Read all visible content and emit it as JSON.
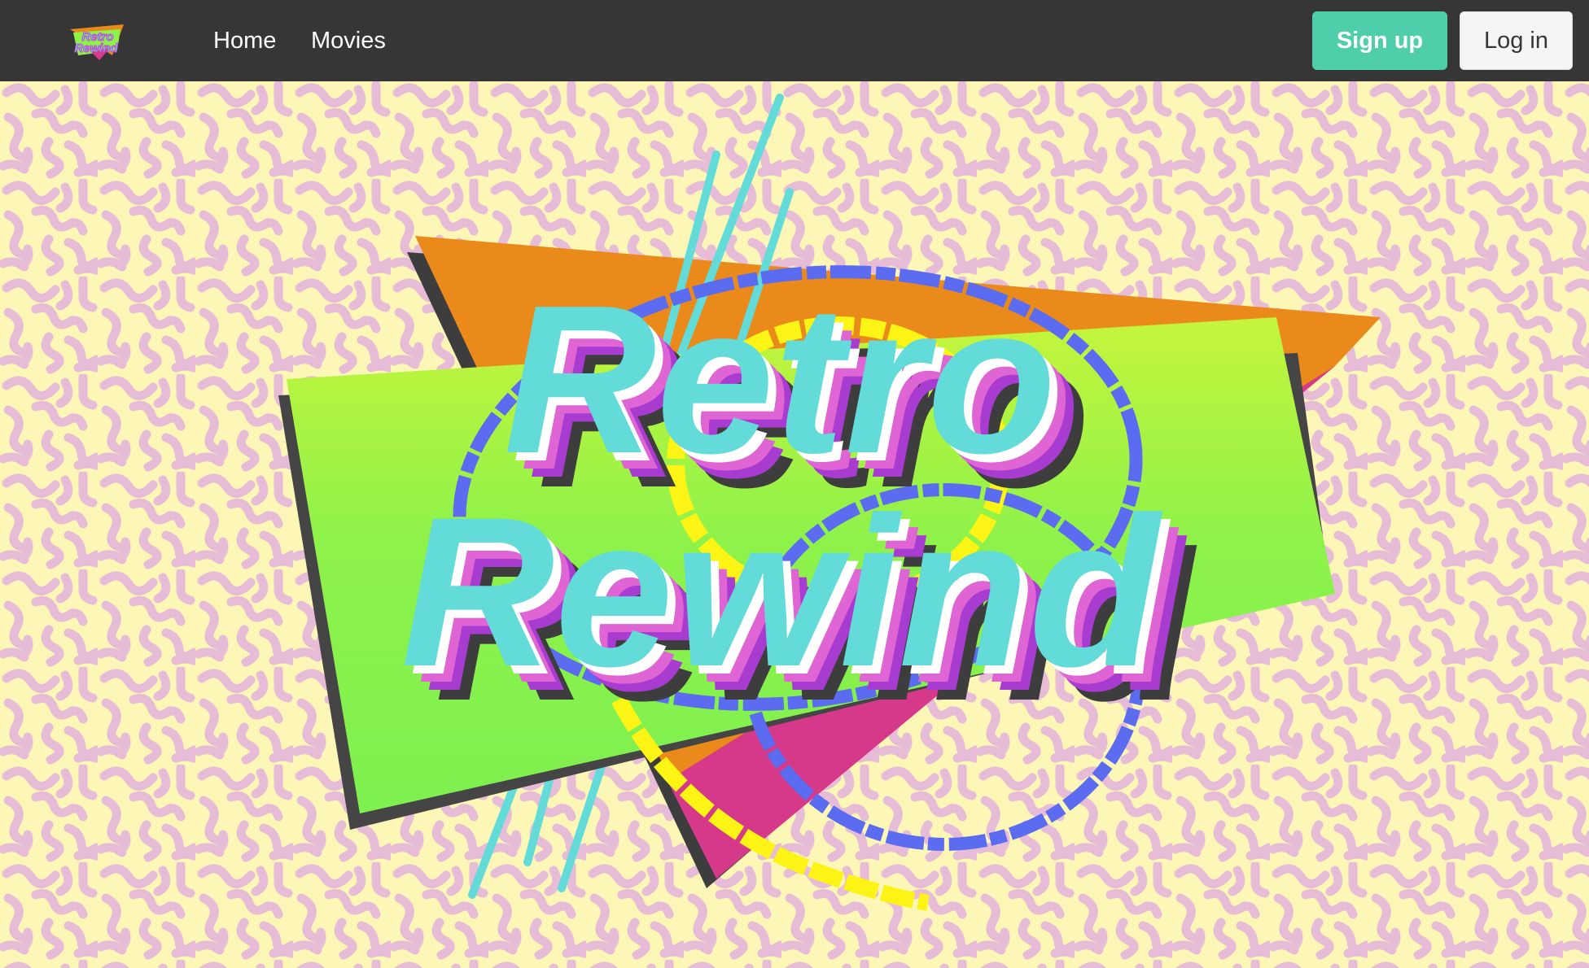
{
  "nav": {
    "logo_alt": "Retro Rewind",
    "links": [
      {
        "label": "Home"
      },
      {
        "label": "Movies"
      }
    ],
    "signup_label": "Sign up",
    "login_label": "Log in"
  },
  "hero": {
    "logo_line1": "Retro",
    "logo_line2": "Rewind"
  },
  "colors": {
    "navbar": "#363636",
    "signup_button": "#4fcfa9",
    "login_button": "#f5f5f5",
    "pattern_pink": "#e7bcd6",
    "pattern_yellow": "#fcf7b7",
    "logo_teal": "#62dbd9",
    "logo_magenta": "#c93fd8",
    "logo_green": "#8ef24a",
    "logo_orange": "#e98a1b",
    "ring_blue": "#5b6cf0",
    "ring_yellow": "#fbf414"
  }
}
